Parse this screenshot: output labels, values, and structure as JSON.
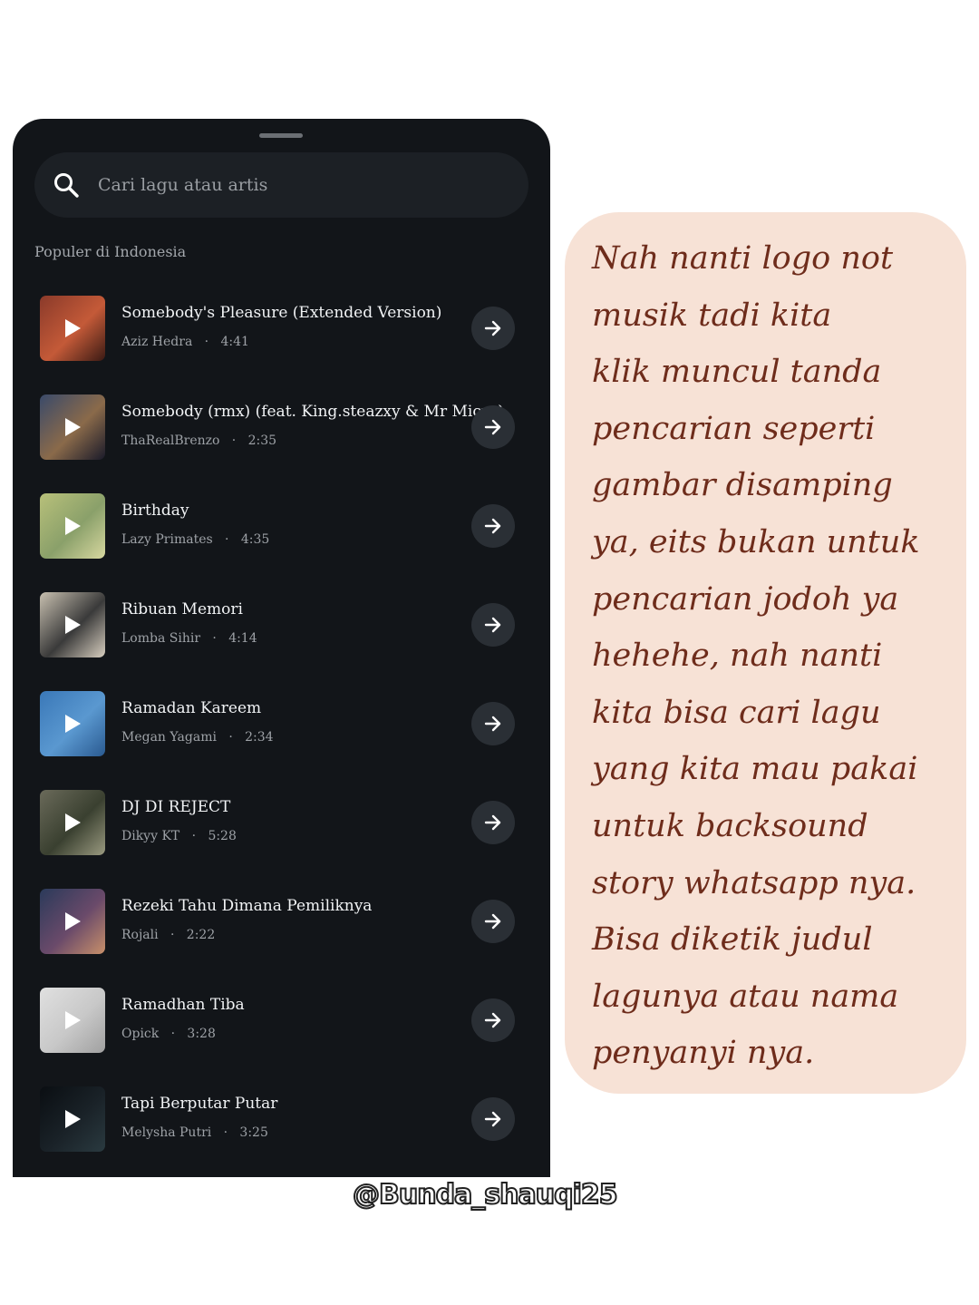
{
  "search": {
    "placeholder": "Cari lagu atau artis"
  },
  "section_title": "Populer di Indonesia",
  "songs": [
    {
      "title": "Somebody's Pleasure (Extended Version)",
      "artist": "Aziz Hedra",
      "duration": "4:41",
      "thumb": [
        "#8a3a2a",
        "#c45a38",
        "#3a1a14"
      ]
    },
    {
      "title": "Somebody (rmx) (feat. King.steazxy & Mr Micro)",
      "artist": "ThaRealBrenzo",
      "duration": "2:35",
      "thumb": [
        "#3a4a6a",
        "#8a6a4a",
        "#1a1a2a"
      ]
    },
    {
      "title": "Birthday",
      "artist": "Lazy Primates",
      "duration": "4:35",
      "thumb": [
        "#b8c07a",
        "#8aa06a",
        "#d8d8a0"
      ]
    },
    {
      "title": "Ribuan Memori",
      "artist": "Lomba Sihir",
      "duration": "4:14",
      "thumb": [
        "#c8c0b0",
        "#3a3a3a",
        "#d8cfc0"
      ]
    },
    {
      "title": "Ramadan Kareem",
      "artist": "Megan Yagami",
      "duration": "2:34",
      "thumb": [
        "#3a78b8",
        "#5a98d0",
        "#2a5a90"
      ]
    },
    {
      "title": "DJ DI REJECT",
      "artist": "Dikyy KT",
      "duration": "5:28",
      "thumb": [
        "#6a6a5a",
        "#3a4030",
        "#9a9a80"
      ]
    },
    {
      "title": "Rezeki Tahu Dimana Pemiliknya",
      "artist": "Rojali",
      "duration": "2:22",
      "thumb": [
        "#2a3a5a",
        "#6a4a6a",
        "#c8906a"
      ]
    },
    {
      "title": "Ramadhan Tiba",
      "artist": "Opick",
      "duration": "3:28",
      "thumb": [
        "#e0e0e0",
        "#c8c8c8",
        "#a0a0a0"
      ]
    },
    {
      "title": "Tapi Berputar Putar",
      "artist": "Melysha Putri",
      "duration": "3:25",
      "thumb": [
        "#0a0e12",
        "#1a2228",
        "#2a3a40"
      ]
    }
  ],
  "note": {
    "lines": [
      "Nah nanti logo not",
      "musik tadi kita",
      "klik muncul tanda",
      "pencarian seperti",
      "gambar disamping",
      "ya, eits bukan untuk",
      "pencarian jodoh ya",
      "hehehe, nah nanti",
      "kita bisa cari lagu",
      "yang kita mau pakai",
      "untuk backsound",
      "story whatsapp nya.",
      "Bisa diketik judul",
      "lagunya atau nama",
      "penyanyi nya."
    ]
  },
  "watermark": "@Bunda_shauqi25"
}
